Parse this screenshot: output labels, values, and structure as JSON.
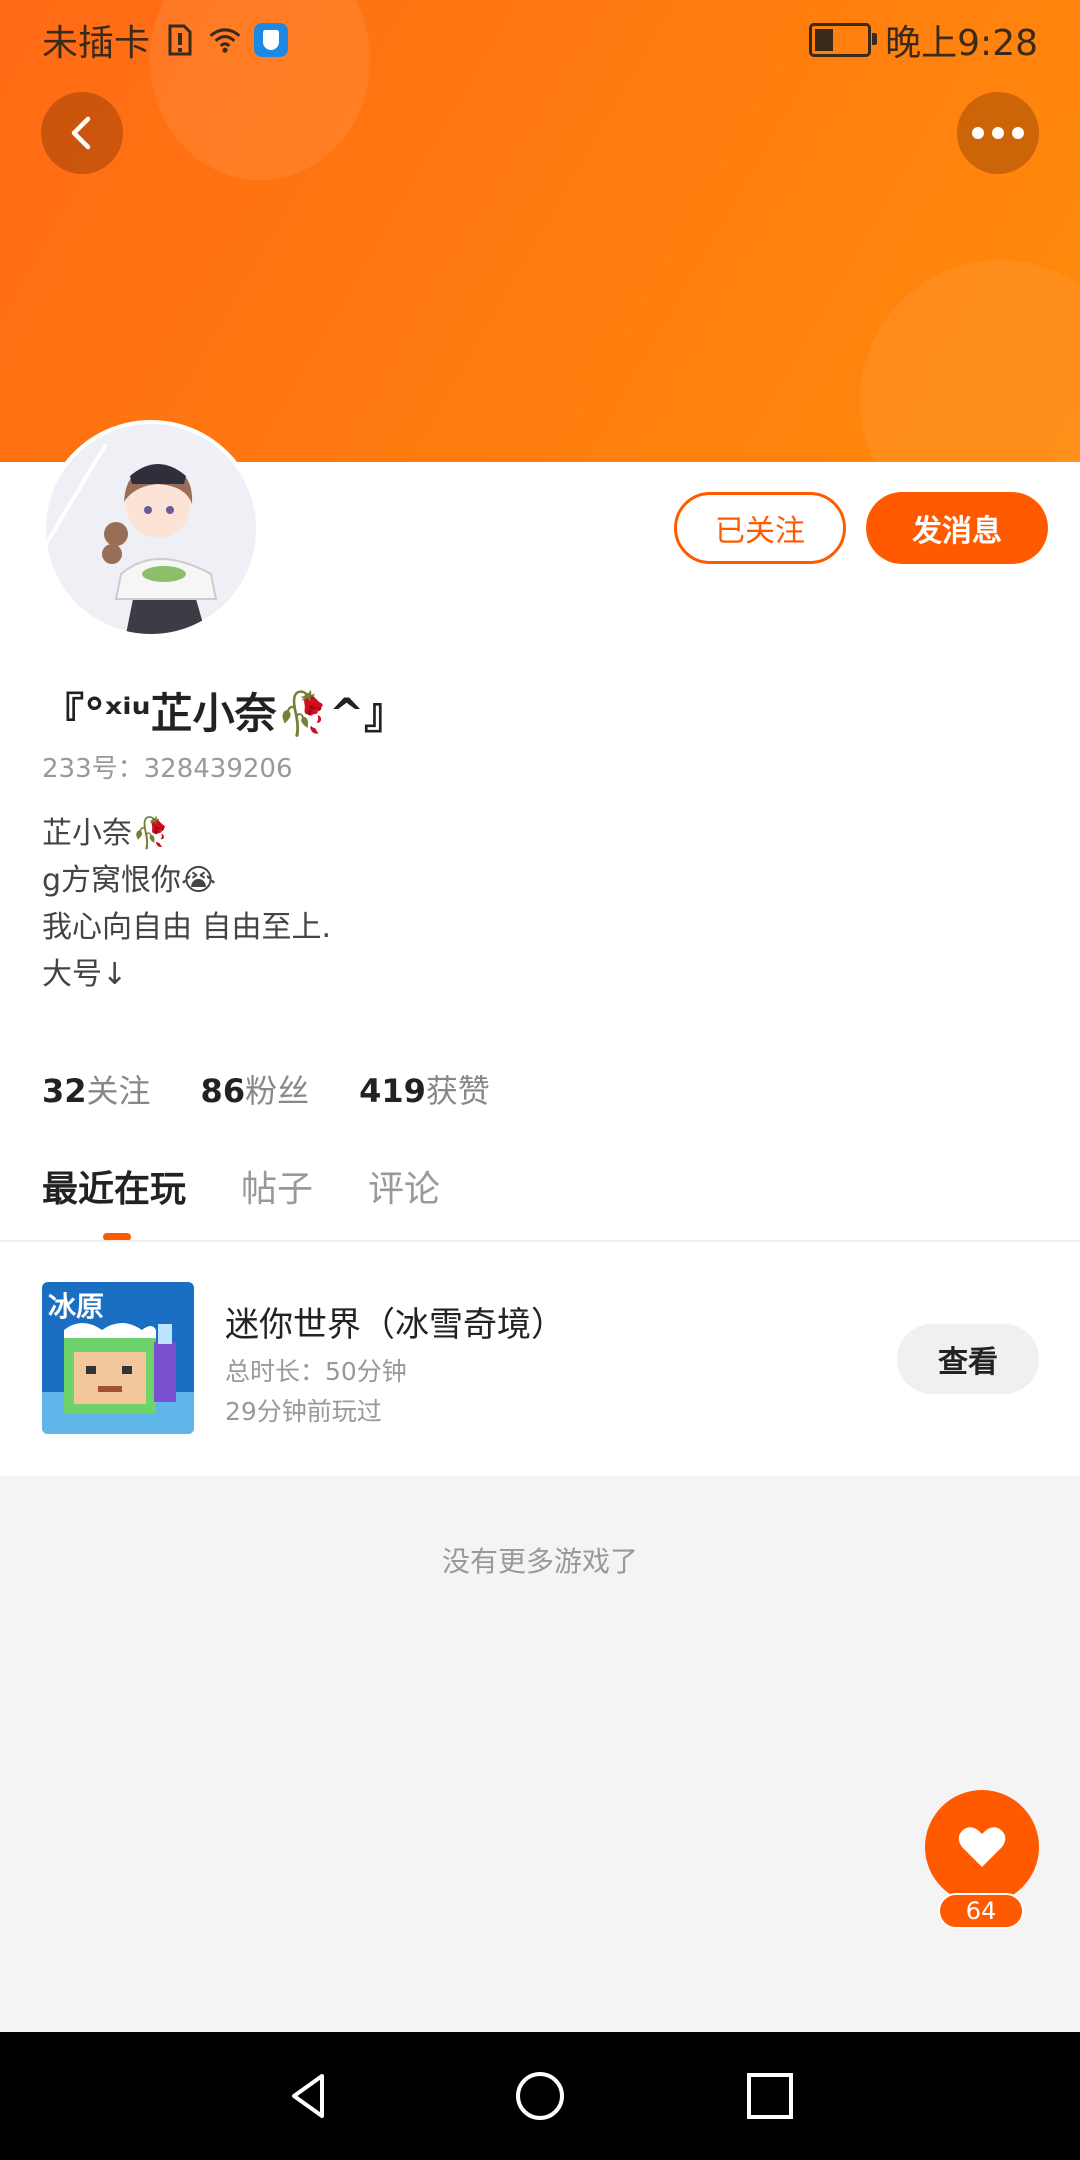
{
  "statusbar": {
    "carrier": "未插卡",
    "time": "晚上9:28"
  },
  "profile": {
    "username": "『°ˣⁱᵘ芷小奈🥀^』",
    "id_line": "233号：328439206",
    "bio": [
      "芷小奈🥀",
      "g方窝恨你😭",
      "我心向自由 自由至上.",
      "大号↓"
    ],
    "follow_button": "已关注",
    "message_button": "发消息"
  },
  "stats": {
    "following_count": "32",
    "following_label": "关注",
    "fans_count": "86",
    "fans_label": "粉丝",
    "likes_count": "419",
    "likes_label": "获赞"
  },
  "tabs": [
    {
      "label": "最近在玩",
      "active": true
    },
    {
      "label": "帖子",
      "active": false
    },
    {
      "label": "评论",
      "active": false
    }
  ],
  "game": {
    "title": "迷你世界（冰雪奇境）",
    "duration": "总时长：50分钟",
    "last_played": "29分钟前玩过",
    "view_button": "查看",
    "icon_text": "冰原"
  },
  "no_more_text": "没有更多游戏了",
  "favorite": {
    "count": "64"
  },
  "colors": {
    "accent": "#ff5a00",
    "header_gradient_start": "#ff6a15",
    "header_gradient_end": "#ff8a0c"
  }
}
